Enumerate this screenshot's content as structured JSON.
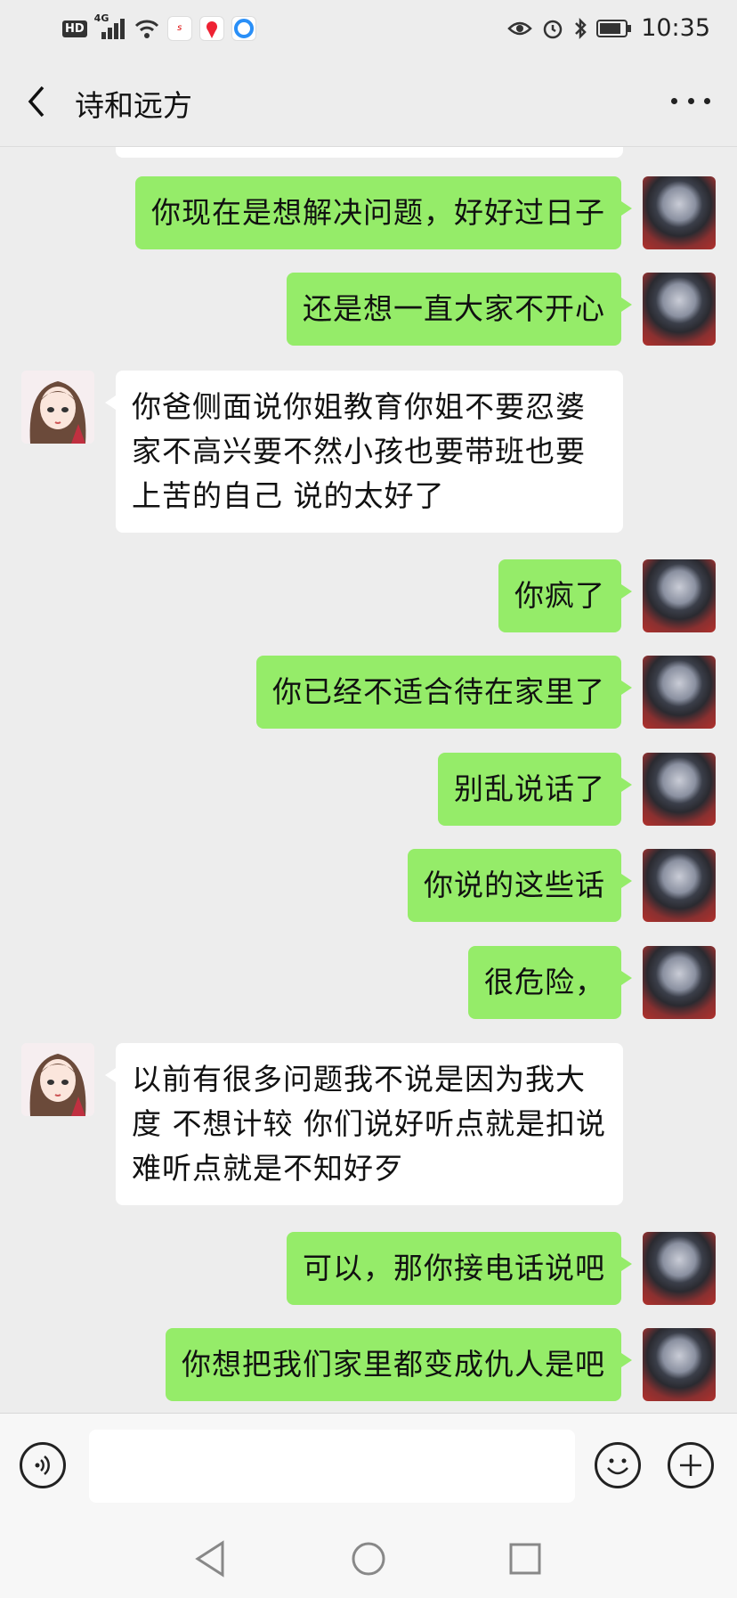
{
  "status_bar": {
    "time": "10:35",
    "network": "4G",
    "hd": "HD"
  },
  "header": {
    "title": "诗和远方"
  },
  "messages": [
    {
      "side": "sent",
      "text": "你现在是想解决问题，好好过日子"
    },
    {
      "side": "sent",
      "text": "还是想一直大家不开心"
    },
    {
      "side": "received",
      "text": "你爸侧面说你姐教育你姐不要忍婆家不高兴要不然小孩也要带班也要上苦的自己  说的太好了"
    },
    {
      "side": "sent",
      "text": "你疯了"
    },
    {
      "side": "sent",
      "text": "你已经不适合待在家里了"
    },
    {
      "side": "sent",
      "text": "别乱说话了"
    },
    {
      "side": "sent",
      "text": "你说的这些话"
    },
    {
      "side": "sent",
      "text": "很危险，"
    },
    {
      "side": "received",
      "text": "以前有很多问题我不说是因为我大度  不想计较  你们说好听点就是扣说难听点就是不知好歹"
    },
    {
      "side": "sent",
      "text": "可以，那你接电话说吧"
    },
    {
      "side": "sent",
      "text": "你想把我们家里都变成仇人是吧"
    }
  ],
  "input": {
    "placeholder": ""
  },
  "colors": {
    "sent_bubble": "#95ec69",
    "received_bubble": "#ffffff",
    "background": "#ededed"
  }
}
